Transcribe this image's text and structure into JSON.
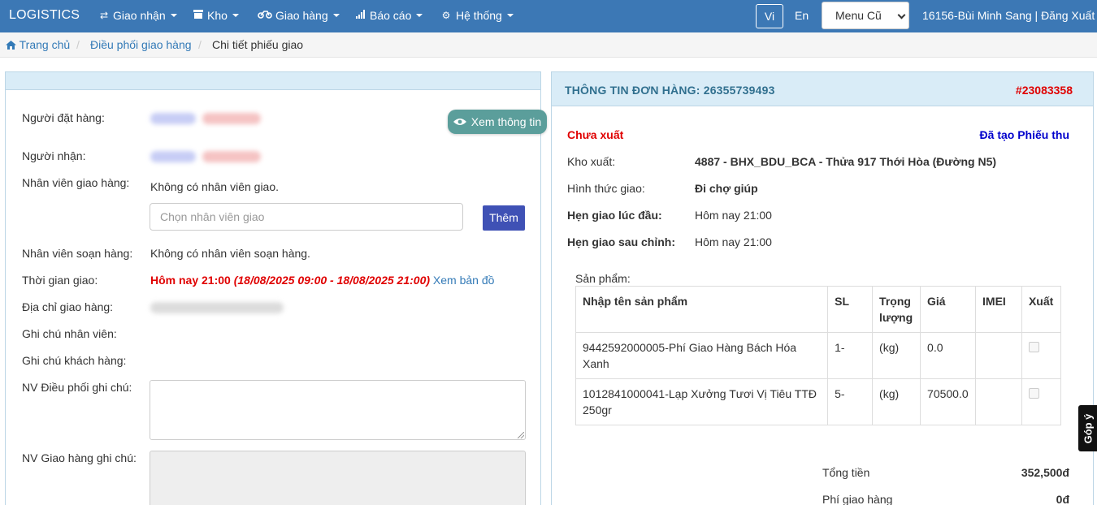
{
  "navbar": {
    "brand": "LOGISTICS",
    "items": [
      {
        "label": "Giao nhận",
        "icon": "exchange-icon"
      },
      {
        "label": "Kho",
        "icon": "box-icon"
      },
      {
        "label": "Giao hàng",
        "icon": "motorbike-icon"
      },
      {
        "label": "Báo cáo",
        "icon": "bar-chart-icon"
      },
      {
        "label": "Hệ thống",
        "icon": "cogs-icon"
      }
    ],
    "lang_vi": "Vi",
    "lang_en": "En",
    "menu_select": "Menu Cũ",
    "user": "16156-Bùi Minh Sang | Đăng Xuất"
  },
  "breadcrumb": {
    "home": "Trang chủ",
    "level2": "Điều phối giao hàng",
    "current": "Chi tiết phiếu giao",
    "separator": "/"
  },
  "left": {
    "xem_thong_tin": "Xem thông tin",
    "nguoi_dat_label": "Người đặt hàng:",
    "nguoi_nhan_label": "Người nhận:",
    "nv_giao_label": "Nhân viên giao hàng:",
    "nv_giao_value": "Không có nhân viên giao.",
    "nv_giao_placeholder": "Chọn nhân viên giao",
    "them_button": "Thêm",
    "nv_soan_label": "Nhân viên soạn hàng:",
    "nv_soan_value": "Không có nhân viên soạn hàng.",
    "thoi_gian_label": "Thời gian giao:",
    "thoi_gian_main": "Hôm nay 21:00",
    "thoi_gian_range": "(18/08/2025 09:00 - 18/08/2025 21:00)",
    "xem_ban_do": "Xem bản đồ",
    "dia_chi_label": "Địa chỉ giao hàng:",
    "ghi_chu_nv_label": "Ghi chú nhân viên:",
    "ghi_chu_kh_label": "Ghi chú khách hàng:",
    "dieu_phoi_label": "NV Điều phối ghi chú:",
    "giao_hang_label": "NV Giao hàng ghi chú:"
  },
  "right": {
    "title": "THÔNG TIN ĐƠN HÀNG: 26355739493",
    "code": "#23083358",
    "status": "Chưa xuất",
    "receipt": "Đã tạo Phiếu thu",
    "kho_label": "Kho xuất:",
    "kho_value": "4887 - BHX_BDU_BCA - Thửa 917 Thới Hòa (Đường N5)",
    "hinh_thuc_label": "Hình thức giao:",
    "hinh_thuc_value": "Đi chợ giúp",
    "hen_dau_label": "Hẹn giao lúc đầu:",
    "hen_dau_value": "Hôm nay 21:00",
    "hen_sau_label": "Hẹn giao sau chỉnh:",
    "hen_sau_value": "Hôm nay 21:00",
    "products_label": "Sản phẩm:",
    "columns": [
      "Nhập tên sản phẩm",
      "SL",
      "Trọng lượng",
      "Giá",
      "IMEI",
      "Xuất"
    ],
    "rows": [
      {
        "name": "9442592000005-Phí Giao Hàng Bách Hóa Xanh",
        "sl": "1-",
        "weight": "(kg)",
        "price": "0.0",
        "imei": ""
      },
      {
        "name": "1012841000041-Lạp Xưởng Tươi Vị Tiêu TTĐ 250gr",
        "sl": "5-",
        "weight": "(kg)",
        "price": "70500.0",
        "imei": ""
      }
    ],
    "total_label": "Tổng tiền",
    "total_value": "352,500đ",
    "ship_label": "Phí giao hàng",
    "ship_value": "0đ"
  },
  "feedback": "Góp ý",
  "colors": {
    "navbar": "#3c78b5",
    "panel_heading": "#d9ecf7",
    "status_red": "#e00000",
    "receipt_blue": "#0000cc",
    "them_button": "#3f51b5",
    "xem_button": "#5b9e9b"
  }
}
